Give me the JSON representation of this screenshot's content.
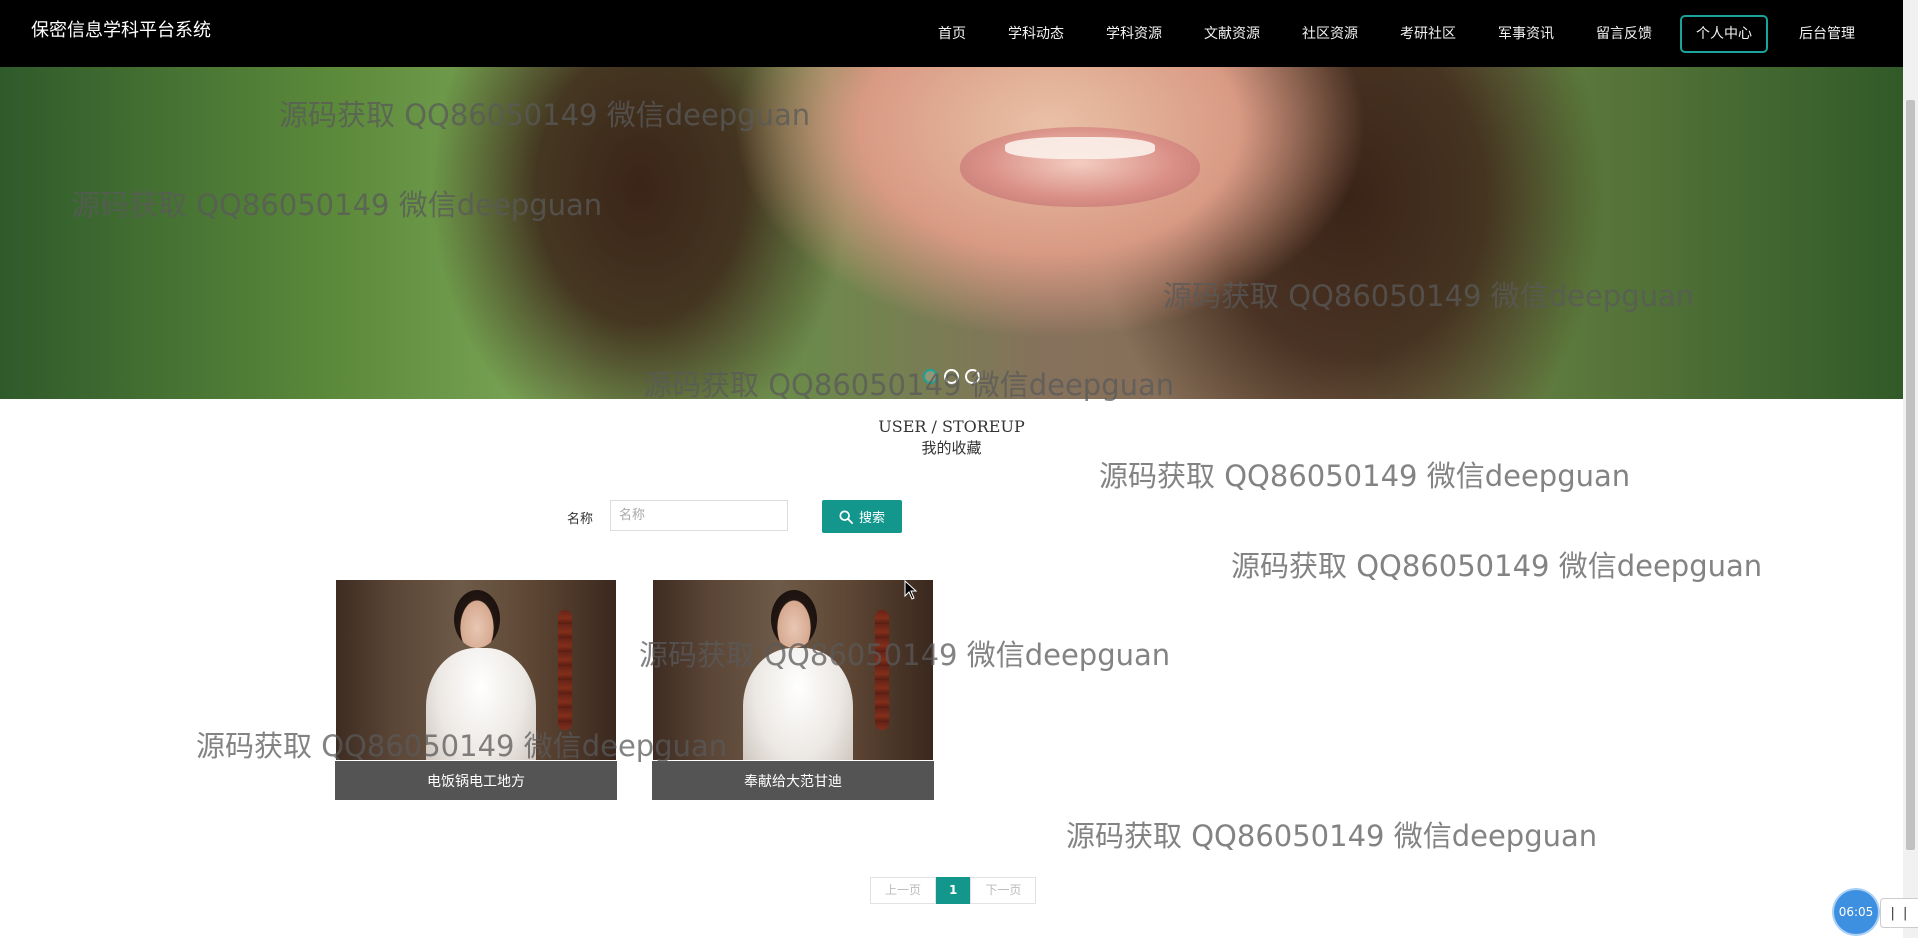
{
  "header": {
    "brand": "保密信息学科平台系统",
    "nav": [
      {
        "label": "首页"
      },
      {
        "label": "学科动态"
      },
      {
        "label": "学科资源"
      },
      {
        "label": "文献资源"
      },
      {
        "label": "社区资源"
      },
      {
        "label": "考研社区"
      },
      {
        "label": "军事资讯"
      },
      {
        "label": "留言反馈"
      },
      {
        "label": "个人中心",
        "active": true
      },
      {
        "label": "后台管理"
      }
    ]
  },
  "banner": {
    "active_slide": 1,
    "slide_count": 3
  },
  "section": {
    "title_en": "USER / STOREUP",
    "title_cn": "我的收藏"
  },
  "search": {
    "label": "名称",
    "placeholder": "名称",
    "value": "",
    "button_label": "搜索"
  },
  "cards": [
    {
      "caption": "电饭锅电工地方"
    },
    {
      "caption": "奉献给大范甘迪"
    }
  ],
  "pagination": {
    "prev_label": "上一页",
    "current_page": "1",
    "next_label": "下一页"
  },
  "watermark": {
    "text": "源码获取 QQ86050149 微信deepguan"
  },
  "clock": {
    "time": "06:05",
    "tab_label": "| |"
  },
  "colors": {
    "accent": "#13978d",
    "topbar": "#000000",
    "caption_bg": "#545454"
  }
}
